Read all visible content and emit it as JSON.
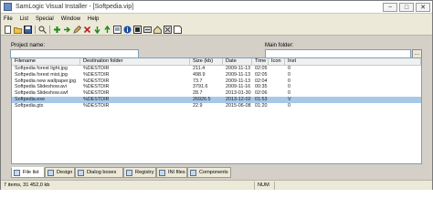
{
  "window": {
    "title": "SamLogic Visual Installer - [Softpedia.vip]",
    "controls": [
      "−",
      "□",
      "✕"
    ]
  },
  "menu": [
    "File",
    "List",
    "Special",
    "Window",
    "Help"
  ],
  "toolbar": {
    "icons": [
      "new-file-icon",
      "open-folder-icon",
      "save-icon",
      "find-icon",
      "add-files-icon",
      "add-file-icon",
      "edit-icon",
      "delete-icon",
      "move-down-icon",
      "move-up-icon",
      "properties-icon",
      "info-icon",
      "icon-icon",
      "settings-icon",
      "home-icon",
      "properties2-icon",
      "help-icon"
    ]
  },
  "form": {
    "project_name_label": "Project name:",
    "project_name_value": "",
    "main_folder_label": "Main folder:",
    "main_folder_value": ""
  },
  "table": {
    "columns": [
      "Filename",
      "Destination folder",
      "Size (kb)",
      "Date",
      "Time",
      "Icon",
      "Inst"
    ],
    "rows": [
      [
        "Softpedia forest light.jpg",
        "%DESTDIR",
        "211.4",
        "2009-11-13",
        "02:05",
        "",
        "0"
      ],
      [
        "Softpedia forest mist.jpg",
        "%DESTDIR",
        "498.9",
        "2009-11-13",
        "02:05",
        "",
        "0"
      ],
      [
        "Softpedia new wallpaper.jpg",
        "%DESTDIR",
        "73.7",
        "2009-11-13",
        "02:04",
        "",
        "0"
      ],
      [
        "Softpedia Slideshow.avi",
        "%DESTDIR",
        "3791.6",
        "2009-11-16",
        "00:35",
        "",
        "0"
      ],
      [
        "Softpedia Slideshow.swf",
        "%DESTDIR",
        "28.7",
        "2013-01-30",
        "02:06",
        "",
        "0"
      ],
      [
        "Softpedia.exe",
        "%DESTDIR",
        "26926.5",
        "2013-12-02",
        "01:53",
        "",
        "V"
      ],
      [
        "Softpedia.gtx",
        "%DESTDIR",
        "22.9",
        "2015-06-08",
        "01:20",
        "",
        "0"
      ]
    ],
    "selected_row": 5
  },
  "tabs": [
    {
      "label": "File list",
      "icon": "file-list-icon"
    },
    {
      "label": "Design",
      "icon": "design-icon"
    },
    {
      "label": "Dialog boxes",
      "icon": "dialog-boxes-icon"
    },
    {
      "label": "Registry",
      "icon": "registry-icon"
    },
    {
      "label": "INI files",
      "icon": "ini-files-icon"
    },
    {
      "label": "Components",
      "icon": "components-icon"
    }
  ],
  "status": {
    "left": "7 items, 31 452,0 kb",
    "right": "NUM"
  }
}
